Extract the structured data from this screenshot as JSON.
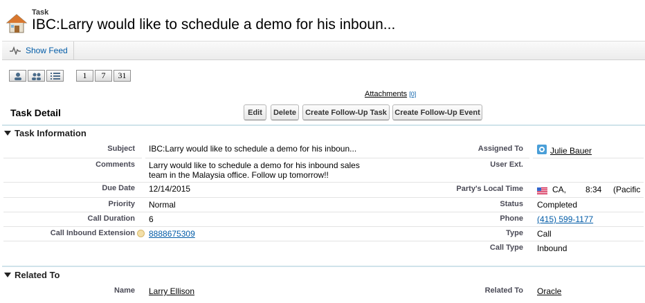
{
  "header": {
    "object_type": "Task",
    "title": "IBC:Larry would like to schedule a demo for his inboun..."
  },
  "feed": {
    "show_feed_label": "Show Feed"
  },
  "calendar_views": {
    "day": "1",
    "week": "7",
    "month": "31"
  },
  "attachments": {
    "label": "Attachments",
    "count": "[0]"
  },
  "detail": {
    "title": "Task Detail",
    "buttons": {
      "edit": "Edit",
      "delete": "Delete",
      "follow_up_task": "Create Follow-Up Task",
      "follow_up_event": "Create Follow-Up Event"
    }
  },
  "task_info": {
    "section_title": "Task Information",
    "subject": {
      "label": "Subject",
      "value": "IBC:Larry would like to schedule a demo for his inboun..."
    },
    "comments": {
      "label": "Comments",
      "line1": "Larry would like to schedule a demo for his inbound sales",
      "line2": "team in the Malaysia office. Follow up tomorrow!!"
    },
    "due_date": {
      "label": "Due Date",
      "value": "12/14/2015"
    },
    "priority": {
      "label": "Priority",
      "value": "Normal"
    },
    "call_duration": {
      "label": "Call Duration",
      "value": "6"
    },
    "call_inbound_ext": {
      "label": "Call Inbound Extension",
      "value": "8888675309"
    },
    "assigned_to": {
      "label": "Assigned To",
      "value": "Julie Bauer"
    },
    "user_ext": {
      "label": "User Ext.",
      "value": ""
    },
    "party_local_time": {
      "label": "Party's Local Time",
      "state": "CA,",
      "time": "8:34",
      "zone": "(Pacific"
    },
    "status": {
      "label": "Status",
      "value": "Completed"
    },
    "phone": {
      "label": "Phone",
      "value": "(415) 599-1177"
    },
    "type": {
      "label": "Type",
      "value": "Call"
    },
    "call_type": {
      "label": "Call Type",
      "value": "Inbound"
    }
  },
  "related_to": {
    "section_title": "Related To",
    "name": {
      "label": "Name",
      "value": "Larry Ellison"
    },
    "related_to": {
      "label": "Related To",
      "value": "Oracle"
    }
  },
  "colors": {
    "link_blue": "#015ba7",
    "section_line": "#cfe3ea",
    "label_gray": "#4a4a56"
  }
}
